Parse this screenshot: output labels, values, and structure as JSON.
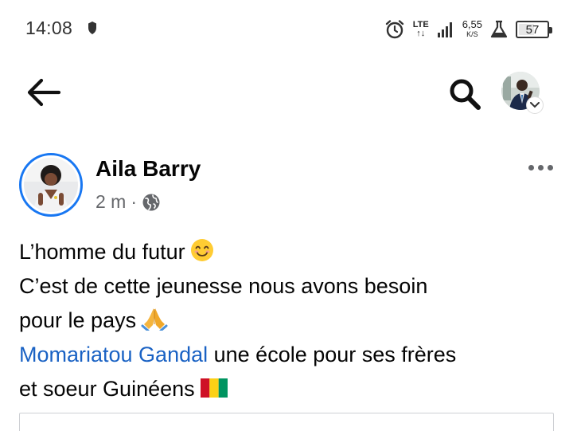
{
  "status_bar": {
    "time": "14:08",
    "network_type": "LTE",
    "network_sub": "↑↓",
    "speed_value": "6,55",
    "speed_unit": "K/S",
    "battery_level": 57,
    "battery_text": "57"
  },
  "nav": {
    "back_icon": "arrow-left-icon",
    "search_icon": "search-icon",
    "profile_icon": "profile-avatar"
  },
  "post": {
    "author": "Aila Barry",
    "time_ago": "2 m",
    "separator": "·",
    "privacy_icon": "globe-icon",
    "lines": {
      "l1": "L’homme du futur",
      "l2": "C’est de cette jeunesse nous avons besoin",
      "l3": "pour le pays",
      "l4_mention": "Momariatou Gandal",
      "l4_rest": " une école pour ses frères",
      "l5": "et soeur Guinéens"
    },
    "emojis": [
      "smiling-face-emoji",
      "folded-hands-emoji",
      "guinea-flag-emoji"
    ]
  },
  "colors": {
    "accent": "#1877f2",
    "mention": "#1a62c4",
    "meta": "#65676b",
    "guinea_red": "#ce1126",
    "guinea_yellow": "#fcd116",
    "guinea_green": "#009460"
  }
}
